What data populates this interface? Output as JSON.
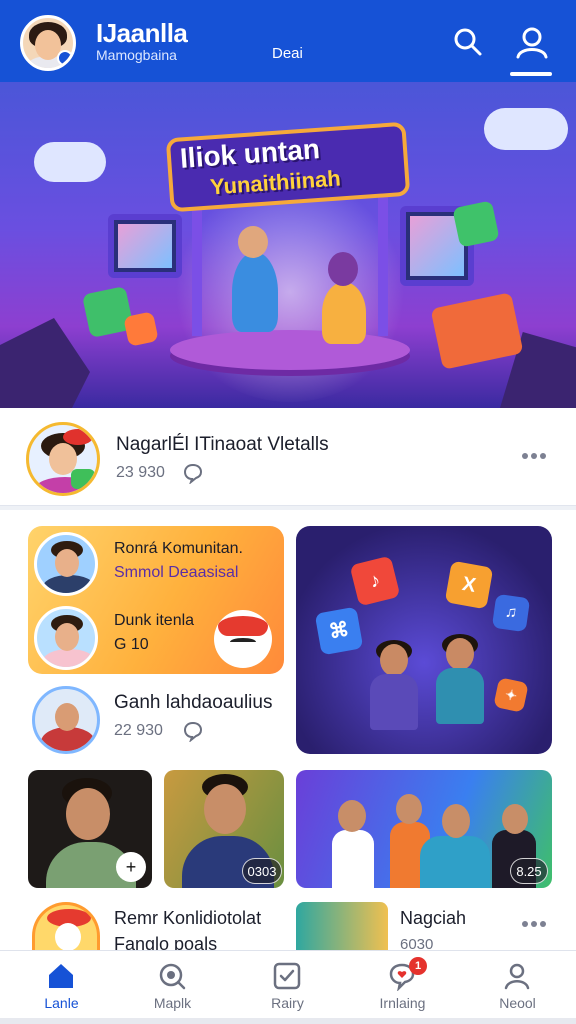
{
  "header": {
    "title": "IJaanlla",
    "subtitle": "Mamogbaina",
    "center_label": "Deai",
    "colors": {
      "brand": "#1652d6"
    },
    "icons": {
      "search": "search-icon",
      "profile": "profile-icon"
    }
  },
  "hero": {
    "line1": "Iliok untan",
    "line2": "Yunaithiinah"
  },
  "featured": {
    "title": "NagarlÉl ITinaoat Vletalls",
    "count": "23 930"
  },
  "promo_card": {
    "line1": "Ronrá Komunitan.",
    "line2": "Smmol Deaasisal",
    "line3": "Dunk itenla",
    "line4": "G 10"
  },
  "games_card": {
    "cube_glyphs": [
      "♪",
      "X",
      "⌘",
      "♫",
      "✦"
    ]
  },
  "post2": {
    "title": "Ganh lahdaoaulius",
    "count": "22 930"
  },
  "thumbs": {
    "t1_plus": "+",
    "t2_pill": "0303",
    "t3_pill": "8.25"
  },
  "row3": {
    "left_line1": "Remr Konlidiotolat",
    "left_line2": "Fanglo poals",
    "right_title": "Nagciah",
    "right_count": "6030"
  },
  "bottom_nav": {
    "items": [
      {
        "label": "Lanle",
        "icon": "home-icon",
        "active": true
      },
      {
        "label": "Maplk",
        "icon": "explore-icon",
        "active": false
      },
      {
        "label": "Rairy",
        "icon": "checkbox-icon",
        "active": false
      },
      {
        "label": "Irnlaing",
        "icon": "chat-heart-icon",
        "active": false,
        "badge": "1"
      },
      {
        "label": "Neool",
        "icon": "profile-icon",
        "active": false
      }
    ]
  }
}
